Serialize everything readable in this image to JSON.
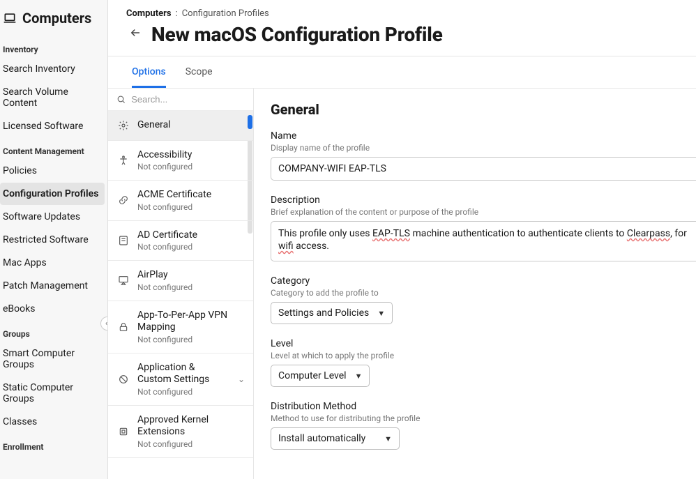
{
  "sidebar": {
    "title": "Computers",
    "sections": [
      {
        "label": "Inventory",
        "items": [
          {
            "label": "Search Inventory"
          },
          {
            "label": "Search Volume Content"
          },
          {
            "label": "Licensed Software"
          }
        ]
      },
      {
        "label": "Content Management",
        "items": [
          {
            "label": "Policies"
          },
          {
            "label": "Configuration Profiles",
            "active": true
          },
          {
            "label": "Software Updates"
          },
          {
            "label": "Restricted Software"
          },
          {
            "label": "Mac Apps"
          },
          {
            "label": "Patch Management"
          },
          {
            "label": "eBooks"
          }
        ]
      },
      {
        "label": "Groups",
        "items": [
          {
            "label": "Smart Computer Groups"
          },
          {
            "label": "Static Computer Groups"
          },
          {
            "label": "Classes"
          }
        ]
      },
      {
        "label": "Enrollment",
        "items": []
      }
    ]
  },
  "breadcrumbs": {
    "root": "Computers",
    "sep": ":",
    "leaf": "Configuration Profiles"
  },
  "page_title": "New macOS Configuration Profile",
  "tabs": [
    {
      "label": "Options",
      "active": true
    },
    {
      "label": "Scope"
    }
  ],
  "search": {
    "placeholder": "Search..."
  },
  "payloads": [
    {
      "name": "General",
      "status": "",
      "icon": "settings",
      "selected": true
    },
    {
      "name": "Accessibility",
      "status": "Not configured",
      "icon": "a11y"
    },
    {
      "name": "ACME Certificate",
      "status": "Not configured",
      "icon": "link"
    },
    {
      "name": "AD Certificate",
      "status": "Not configured",
      "icon": "id"
    },
    {
      "name": "AirPlay",
      "status": "Not configured",
      "icon": "display"
    },
    {
      "name": "App-To-Per-App VPN Mapping",
      "status": "Not configured",
      "icon": "lock"
    },
    {
      "name": "Application & Custom Settings",
      "status": "Not configured",
      "icon": "block",
      "chevron": true
    },
    {
      "name": "Approved Kernel Extensions",
      "status": "Not configured",
      "icon": "kernel"
    }
  ],
  "form": {
    "heading": "General",
    "name_label": "Name",
    "name_help": "Display name of the profile",
    "name_value": "COMPANY-WIFI EAP-TLS",
    "desc_label": "Description",
    "desc_help": "Brief explanation of the content or purpose of the profile",
    "desc_value_parts": {
      "p1": "This profile only uses ",
      "sq1": "EAP-TLS",
      "p2": " machine authentication to authenticate clients to ",
      "sq2": "Clearpass",
      "p3": ", for ",
      "sq3": "wifi",
      "p4": " access."
    },
    "category_label": "Category",
    "category_help": "Category to add the profile to",
    "category_value": "Settings and Policies",
    "level_label": "Level",
    "level_help": "Level at which to apply the profile",
    "level_value": "Computer Level",
    "dist_label": "Distribution Method",
    "dist_help": "Method to use for distributing the profile",
    "dist_value": "Install automatically"
  }
}
